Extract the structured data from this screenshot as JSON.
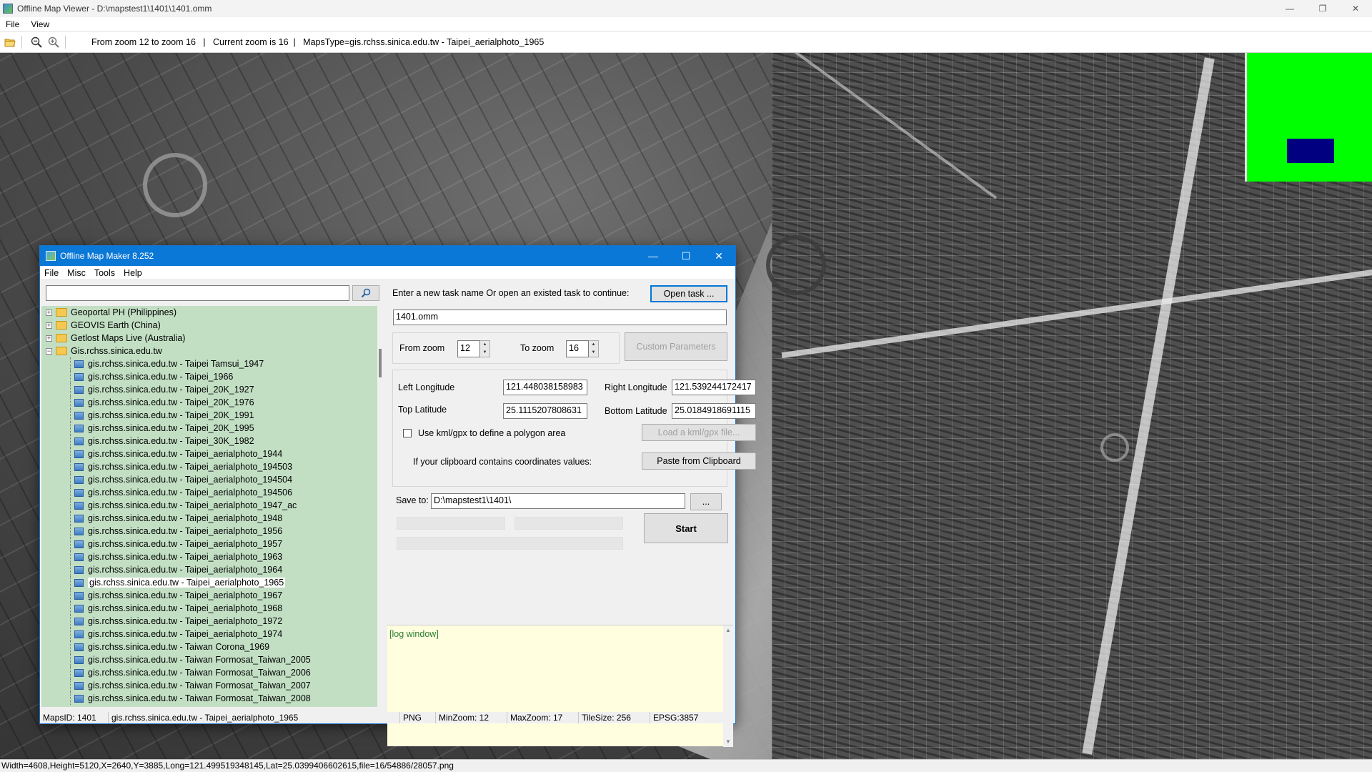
{
  "viewer": {
    "title": "Offline Map Viewer - D:\\mapstest1\\1401\\1401.omm",
    "menu": [
      "File",
      "View"
    ],
    "toolbar_info": "From zoom 12 to zoom 16   |   Current zoom is 16  |   MapsType=gis.rchss.sinica.edu.tw - Taipei_aerialphoto_1965",
    "status": "Width=4608,Height=5120,X=2640,Y=3885,Long=121.499519348145,Lat=25.0399406602615,file=16/54886/28057.png",
    "overview_color": "#00ff00",
    "overview_viewport_color": "#000080"
  },
  "dialog": {
    "title": "Offline Map Maker 8.252",
    "menu": [
      "File",
      "Misc",
      "Tools",
      "Help"
    ],
    "search": {
      "value": "",
      "placeholder": ""
    },
    "tree": {
      "folders": [
        {
          "label": "Geoportal PH (Philippines)",
          "expander": "+"
        },
        {
          "label": "GEOVIS Earth (China)",
          "expander": "+"
        },
        {
          "label": "Getlost Maps Live (Australia)",
          "expander": "+"
        },
        {
          "label": "Gis.rchss.sinica.edu.tw",
          "expander": "−"
        }
      ],
      "children": [
        "gis.rchss.sinica.edu.tw - Taipei Tamsui_1947",
        "gis.rchss.sinica.edu.tw - Taipei_1966",
        "gis.rchss.sinica.edu.tw - Taipei_20K_1927",
        "gis.rchss.sinica.edu.tw - Taipei_20K_1976",
        "gis.rchss.sinica.edu.tw - Taipei_20K_1991",
        "gis.rchss.sinica.edu.tw - Taipei_20K_1995",
        "gis.rchss.sinica.edu.tw - Taipei_30K_1982",
        "gis.rchss.sinica.edu.tw - Taipei_aerialphoto_1944",
        "gis.rchss.sinica.edu.tw - Taipei_aerialphoto_194503",
        "gis.rchss.sinica.edu.tw - Taipei_aerialphoto_194504",
        "gis.rchss.sinica.edu.tw - Taipei_aerialphoto_194506",
        "gis.rchss.sinica.edu.tw - Taipei_aerialphoto_1947_ac",
        "gis.rchss.sinica.edu.tw - Taipei_aerialphoto_1948",
        "gis.rchss.sinica.edu.tw - Taipei_aerialphoto_1956",
        "gis.rchss.sinica.edu.tw - Taipei_aerialphoto_1957",
        "gis.rchss.sinica.edu.tw - Taipei_aerialphoto_1963",
        "gis.rchss.sinica.edu.tw - Taipei_aerialphoto_1964",
        "gis.rchss.sinica.edu.tw - Taipei_aerialphoto_1965",
        "gis.rchss.sinica.edu.tw - Taipei_aerialphoto_1967",
        "gis.rchss.sinica.edu.tw - Taipei_aerialphoto_1968",
        "gis.rchss.sinica.edu.tw - Taipei_aerialphoto_1972",
        "gis.rchss.sinica.edu.tw - Taipei_aerialphoto_1974",
        "gis.rchss.sinica.edu.tw - Taiwan Corona_1969",
        "gis.rchss.sinica.edu.tw - Taiwan Formosat_Taiwan_2005",
        "gis.rchss.sinica.edu.tw - Taiwan Formosat_Taiwan_2006",
        "gis.rchss.sinica.edu.tw - Taiwan Formosat_Taiwan_2007",
        "gis.rchss.sinica.edu.tw - Taiwan Formosat_Taiwan_2008"
      ],
      "selected": "gis.rchss.sinica.edu.tw - Taipei_aerialphoto_1965"
    },
    "task_prompt": "Enter a new task name Or open an existed task to continue:",
    "open_task_label": "Open task ...",
    "task_name": "1401.omm",
    "from_zoom_label": "From zoom",
    "from_zoom": "12",
    "to_zoom_label": "To zoom",
    "to_zoom": "16",
    "custom_params_label": "Custom Parameters",
    "left_long_label": "Left Longitude",
    "left_long": "121.448038158983",
    "right_long_label": "Right Longitude",
    "right_long": "121.539244172417",
    "top_lat_label": "Top Latitude",
    "top_lat": "25.1115207808631",
    "bottom_lat_label": "Bottom Latitude",
    "bottom_lat": "25.0184918691115",
    "kml_label": "Use kml/gpx to define a polygon area",
    "kml_checked": false,
    "load_kml_label": "Load a kml/gpx file...",
    "clipboard_prompt": "If your clipboard contains coordinates values:",
    "paste_label": "Paste from Clipboard",
    "save_to_label": "Save to:",
    "save_to": "D:\\mapstest1\\1401\\",
    "browse_label": "...",
    "start_label": "Start",
    "log_text": "[log window]",
    "status": {
      "maps_id": "MapsID: 1401",
      "maps_name": "gis.rchss.sinica.edu.tw - Taipei_aerialphoto_1965",
      "format": "PNG",
      "min_zoom": "MinZoom: 12",
      "max_zoom": "MaxZoom: 17",
      "tile_size": "TileSize: 256",
      "epsg": "EPSG:3857"
    }
  }
}
